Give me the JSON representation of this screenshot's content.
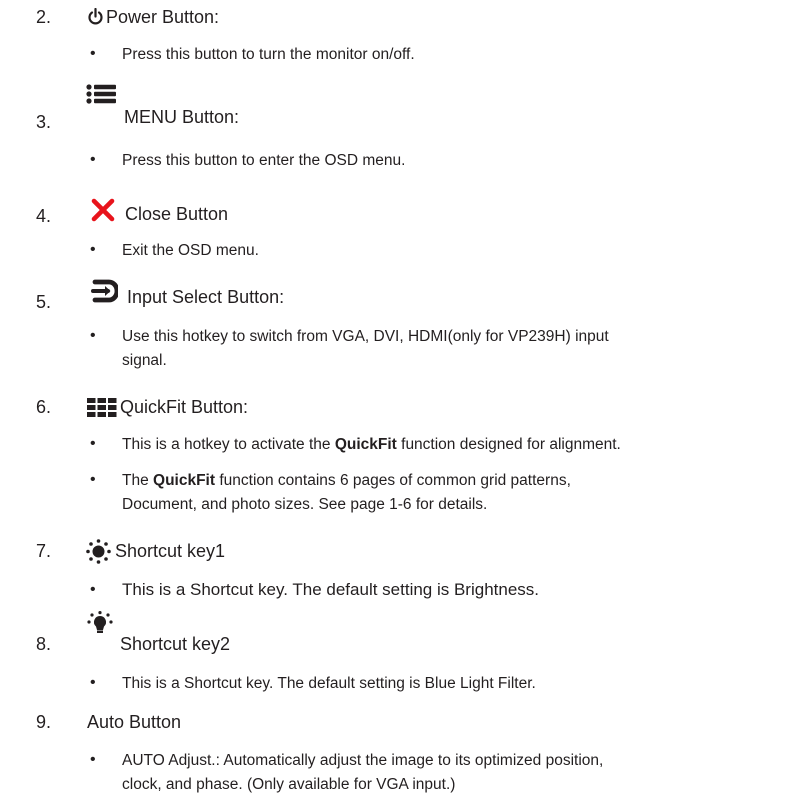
{
  "items": [
    {
      "num": "2.",
      "title": "Power Button:",
      "icon": "power-icon",
      "bullets": [
        {
          "text": "Press this button to turn the monitor on/off."
        }
      ]
    },
    {
      "num": "3.",
      "title": "MENU Button:",
      "icon": "menu-icon",
      "bullets": [
        {
          "text": "Press this button to enter the OSD menu."
        }
      ]
    },
    {
      "num": "4.",
      "title": "Close Button",
      "icon": "close-icon",
      "bullets": [
        {
          "text": "Exit the OSD menu."
        }
      ]
    },
    {
      "num": "5.",
      "title": "Input Select Button:",
      "icon": "input-select-icon",
      "bullets": [
        {
          "line1": "Use this hotkey to switch from VGA, DVI, HDMI(only for VP239H) input",
          "line2": "signal."
        }
      ]
    },
    {
      "num": "6.",
      "title": "QuickFit Button:",
      "icon": "quickfit-grid-icon",
      "bullets": [
        {
          "pre": "This is a hotkey to activate the ",
          "bold": "QuickFit",
          "post": " function designed for alignment."
        },
        {
          "pre": "The ",
          "bold": "QuickFit",
          "post": " function contains 6 pages of common grid patterns,",
          "line2": "Document, and photo sizes. See page 1-6 for details."
        }
      ]
    },
    {
      "num": "7.",
      "title": "Shortcut key1",
      "icon": "brightness-icon",
      "bullets": [
        {
          "text": "This is a Shortcut key. The default setting is Brightness."
        }
      ]
    },
    {
      "num": "8.",
      "title": "Shortcut key2",
      "icon": "blue-light-icon",
      "bullets": [
        {
          "text": "This is a Shortcut key. The default setting is Blue Light Filter."
        }
      ]
    },
    {
      "num": "9.",
      "title": "Auto Button",
      "icon": "",
      "bullets": [
        {
          "line1": "AUTO Adjust.: Automatically adjust the image to its optimized position,",
          "line2": "clock, and phase. (Only available for VGA input.)"
        }
      ]
    }
  ],
  "colors": {
    "text": "#231f20",
    "close_icon": "#e8141c"
  }
}
